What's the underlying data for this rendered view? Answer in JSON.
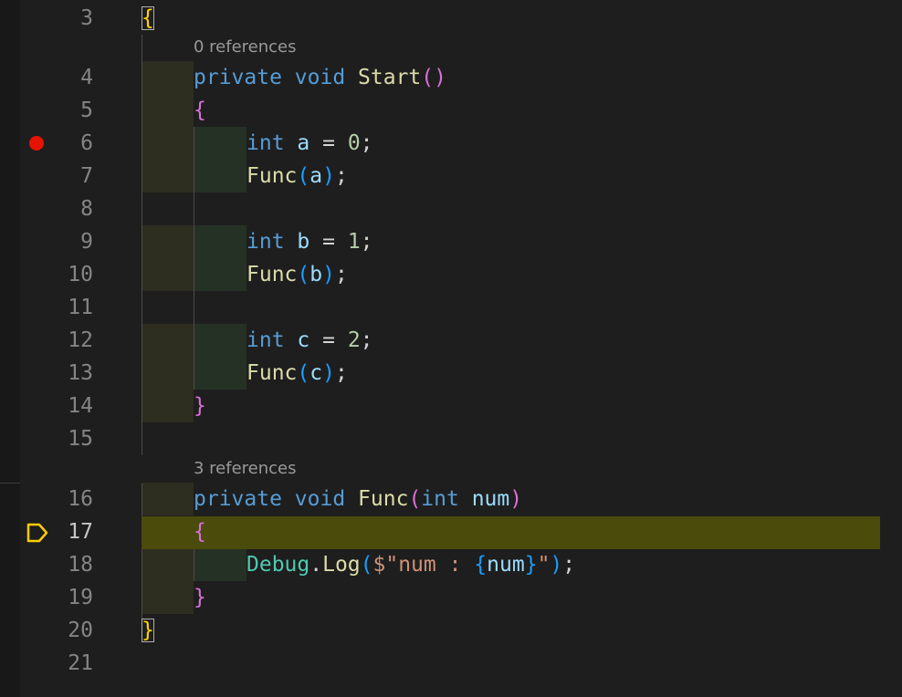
{
  "colors": {
    "background": "#1e1e1e",
    "current_line": "#4b4b0c",
    "breakpoint": "#e51400",
    "execution_pointer": "#ffcc00",
    "keyword": "#569cd6",
    "function": "#dcdcaa",
    "variable": "#9cdcfe",
    "number": "#b5cea8",
    "string": "#ce9178",
    "type": "#4ec9b0"
  },
  "gutter": {
    "line_numbers": [
      "3",
      "4",
      "5",
      "6",
      "7",
      "8",
      "9",
      "10",
      "11",
      "12",
      "13",
      "14",
      "15",
      "16",
      "17",
      "18",
      "19",
      "20",
      "21"
    ],
    "breakpoint_icon": "breakpoint-dot-icon",
    "execution_icon": "execution-pointer-icon"
  },
  "codelens": {
    "start_refs": "0 references",
    "func_refs": "3 references"
  },
  "tokens": {
    "l3": [
      "{"
    ],
    "l4": [
      "private",
      " ",
      "void",
      " ",
      "Start",
      "(",
      ")"
    ],
    "l5": [
      "{"
    ],
    "l6": [
      "int",
      " ",
      "a",
      " = ",
      "0",
      ";"
    ],
    "l7": [
      "Func",
      "(",
      "a",
      ")",
      ";"
    ],
    "l9": [
      "int",
      " ",
      "b",
      " = ",
      "1",
      ";"
    ],
    "l10": [
      "Func",
      "(",
      "b",
      ")",
      ";"
    ],
    "l12": [
      "int",
      " ",
      "c",
      " = ",
      "2",
      ";"
    ],
    "l13": [
      "Func",
      "(",
      "c",
      ")",
      ";"
    ],
    "l14": [
      "}"
    ],
    "l16": [
      "private",
      " ",
      "void",
      " ",
      "Func",
      "(",
      "int",
      " ",
      "num",
      ")"
    ],
    "l17": [
      "{"
    ],
    "l18": [
      "Debug",
      ".",
      "Log",
      "(",
      "$\"num : ",
      "{",
      "num",
      "}",
      "\"",
      ")",
      ";"
    ],
    "l19": [
      "}"
    ],
    "l20": [
      "}"
    ]
  }
}
